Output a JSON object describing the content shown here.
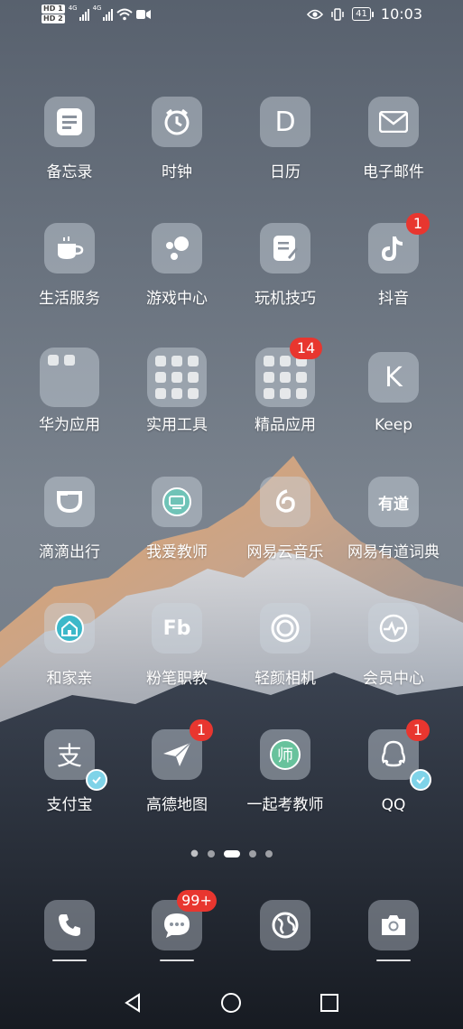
{
  "status_bar": {
    "sim1": "HD 1",
    "sim2": "HD 2",
    "net1": "4G",
    "net2": "4G",
    "battery": "41",
    "time": "10:03"
  },
  "apps": [
    {
      "label": "备忘录",
      "icon": "notes-icon"
    },
    {
      "label": "时钟",
      "icon": "clock-icon"
    },
    {
      "label": "日历",
      "icon": "calendar-icon",
      "glyph": "D"
    },
    {
      "label": "电子邮件",
      "icon": "mail-icon"
    },
    {
      "label": "生活服务",
      "icon": "coffee-cup-icon"
    },
    {
      "label": "游戏中心",
      "icon": "game-center-icon"
    },
    {
      "label": "玩机技巧",
      "icon": "tips-icon"
    },
    {
      "label": "抖音",
      "icon": "douyin-icon",
      "badge": "1"
    },
    {
      "label": "华为应用",
      "icon": "folder-icon"
    },
    {
      "label": "实用工具",
      "icon": "folder-icon"
    },
    {
      "label": "精品应用",
      "icon": "folder-icon",
      "badge": "14"
    },
    {
      "label": "Keep",
      "icon": "keep-icon",
      "glyph": "K"
    },
    {
      "label": "滴滴出行",
      "icon": "didi-icon"
    },
    {
      "label": "我爱教师",
      "icon": "teacher-icon"
    },
    {
      "label": "网易云音乐",
      "icon": "netease-music-icon"
    },
    {
      "label": "网易有道词典",
      "icon": "youdao-icon",
      "glyph": "有道"
    },
    {
      "label": "和家亲",
      "icon": "home-icon"
    },
    {
      "label": "粉笔职教",
      "icon": "fenbi-icon",
      "glyph": "Fb"
    },
    {
      "label": "轻颜相机",
      "icon": "camera-lens-icon"
    },
    {
      "label": "会员中心",
      "icon": "pulse-icon"
    },
    {
      "label": "支付宝",
      "icon": "alipay-icon",
      "glyph": "支",
      "verified": true
    },
    {
      "label": "高德地图",
      "icon": "paper-plane-icon",
      "badge": "1"
    },
    {
      "label": "一起考教师",
      "icon": "teacher-exam-icon",
      "glyph": "师"
    },
    {
      "label": "QQ",
      "icon": "qq-penguin-icon",
      "badge": "1",
      "verified": true
    }
  ],
  "dock": [
    {
      "icon": "phone-icon"
    },
    {
      "icon": "messages-icon",
      "badge": "99+"
    },
    {
      "icon": "browser-globe-icon"
    },
    {
      "icon": "camera-icon"
    }
  ],
  "colors": {
    "badge": "#e8362f",
    "verify": "#7fd3e8",
    "icon_tile": "#cdd4de"
  }
}
